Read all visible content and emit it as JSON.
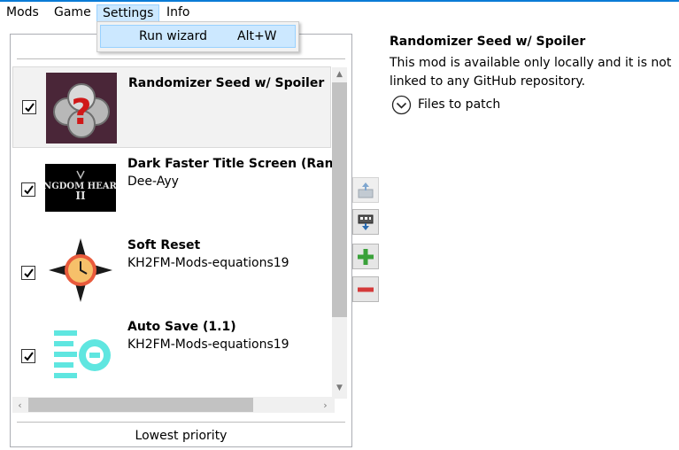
{
  "menu": {
    "items": [
      "Mods",
      "Game",
      "Settings",
      "Info"
    ],
    "open_menu": "Settings",
    "dropdown": [
      {
        "label": "Run wizard",
        "shortcut": "Alt+W"
      }
    ]
  },
  "mod_list": {
    "mods": [
      {
        "title": "Randomizer Seed w/ Spoiler",
        "author": "",
        "checked": true,
        "selected": true,
        "icon": "randomizer-icon"
      },
      {
        "title": "Dark Faster Title Screen (Rando T",
        "author": "Dee-Ayy",
        "checked": true,
        "selected": false,
        "icon": "kingdom-hearts-logo-icon"
      },
      {
        "title": "Soft Reset",
        "author": "KH2FM-Mods-equations19",
        "checked": true,
        "selected": false,
        "icon": "soft-reset-icon"
      },
      {
        "title": "Auto Save (1.1)",
        "author": "KH2FM-Mods-equations19",
        "checked": true,
        "selected": false,
        "icon": "auto-save-icon"
      }
    ],
    "bottom_label": "Lowest priority"
  },
  "side_buttons": [
    "move-up-icon",
    "move-down-icon",
    "add-icon",
    "remove-icon"
  ],
  "details": {
    "title": "Randomizer Seed w/ Spoiler",
    "description": "This mod is available only locally and it is not linked to any GitHub repository.",
    "files_label": "Files to patch"
  },
  "colors": {
    "accent": "#0a7bd6",
    "menu_highlight": "#cce8ff",
    "add_green": "#3aa13a",
    "remove_red": "#d43a3a"
  }
}
